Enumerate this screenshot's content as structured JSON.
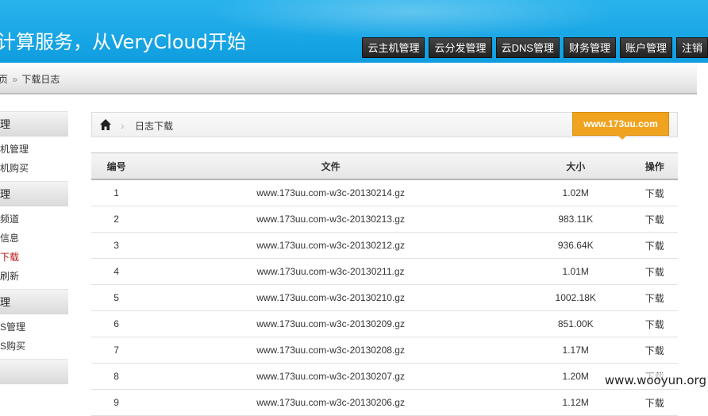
{
  "header": {
    "slogan": "计算服务，从VeryCloud开始",
    "nav": [
      "云主机管理",
      "云分发管理",
      "云DNS管理",
      "财务管理",
      "账户管理",
      "注销"
    ]
  },
  "breadcrumb": {
    "prev": "页",
    "separator": "»",
    "current": "下载日志"
  },
  "sidebar": {
    "sections": [
      {
        "head": "理",
        "items": [
          "机管理",
          "机购买"
        ]
      },
      {
        "head": "理",
        "items": [
          "频道",
          "信息",
          "下载",
          "刷新"
        ]
      },
      {
        "head": "理",
        "items": [
          "S管理",
          "S购买"
        ]
      },
      {
        "head": "",
        "items": []
      }
    ],
    "active_item": "下载"
  },
  "main": {
    "path_label": "日志下载",
    "badge": "www.173uu.com",
    "columns": [
      "编号",
      "文件",
      "大小",
      "操作"
    ],
    "rows": [
      {
        "no": "1",
        "file": "www.173uu.com-w3c-20130214.gz",
        "size": "1.02M",
        "op": "下载"
      },
      {
        "no": "2",
        "file": "www.173uu.com-w3c-20130213.gz",
        "size": "983.11K",
        "op": "下载"
      },
      {
        "no": "3",
        "file": "www.173uu.com-w3c-20130212.gz",
        "size": "936.64K",
        "op": "下载"
      },
      {
        "no": "4",
        "file": "www.173uu.com-w3c-20130211.gz",
        "size": "1.01M",
        "op": "下载"
      },
      {
        "no": "5",
        "file": "www.173uu.com-w3c-20130210.gz",
        "size": "1002.18K",
        "op": "下载"
      },
      {
        "no": "6",
        "file": "www.173uu.com-w3c-20130209.gz",
        "size": "851.00K",
        "op": "下载"
      },
      {
        "no": "7",
        "file": "www.173uu.com-w3c-20130208.gz",
        "size": "1.17M",
        "op": "下载"
      },
      {
        "no": "8",
        "file": "www.173uu.com-w3c-20130207.gz",
        "size": "1.20M",
        "op": "下载"
      },
      {
        "no": "9",
        "file": "www.173uu.com-w3c-20130206.gz",
        "size": "1.12M",
        "op": "下载"
      }
    ]
  },
  "watermark": "www.wooyun.org",
  "colors": {
    "header_blue": "#1aa7e6",
    "badge_orange": "#f0a31f",
    "active_red": "#b71313"
  }
}
